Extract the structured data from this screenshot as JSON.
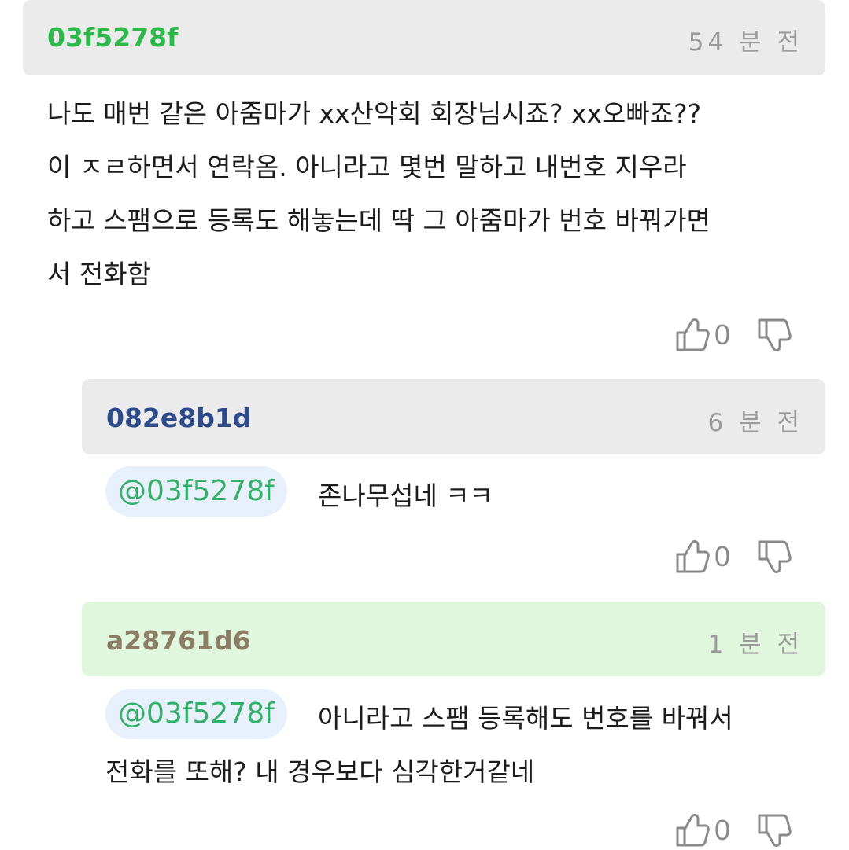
{
  "main_comment": {
    "user_id": "03f5278f",
    "user_color": "#2db84c",
    "time": "54 분 전",
    "lines": [
      "나도 매번 같은 아줌마가 xx산악회 회장님시죠? xx오빠죠??",
      "이 ㅈㄹ하면서 연락옴. 아니라고 몇번 말하고 내번호 지우라",
      "하고 스팸으로 등록도 해놓는데 딱 그 아줌마가 번호 바꿔가면",
      "서 전화함"
    ],
    "like_count": "0"
  },
  "reply_1": {
    "user_id": "082e8b1d",
    "user_color": "#2d4a8a",
    "time": "6 분 전",
    "mention": "@03f5278f",
    "text": "존나무섭네 ㅋㅋ",
    "like_count": "0"
  },
  "reply_2": {
    "user_id": "a28761d6",
    "user_color": "#8b7d66",
    "time": "1 분 전",
    "mention": "@03f5278f",
    "line1": "아니라고 스팸 등록해도 번호를 바꿔서",
    "line2": "전화를 또해? 내 경우보다 심각한거같네",
    "like_count": "0"
  },
  "icons": {
    "like": "thumbs-up-icon",
    "dislike": "thumbs-down-icon"
  }
}
